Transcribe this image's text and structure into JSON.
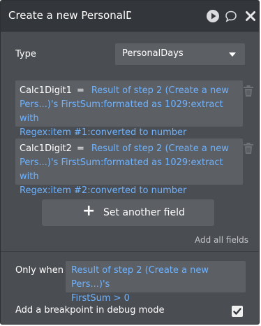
{
  "header": {
    "title": "Create a new PersonalDa",
    "icons": [
      "play-icon",
      "comment-icon",
      "close-icon"
    ]
  },
  "type_row": {
    "label": "Type",
    "value": "PersonalDays"
  },
  "fields": [
    {
      "name": "Calc1Digit1",
      "eq": "=",
      "expr_line1": "Result of step 2 (Create a new",
      "expr_line2": "Pers...)'s FirstSum:formatted as 1029:extract with",
      "expr_line3": "Regex:item #1:converted to number"
    },
    {
      "name": "Calc1Digit2",
      "eq": "=",
      "expr_line1": "Result of step 2 (Create a new",
      "expr_line2": "Pers...)'s FirstSum:formatted as 1029:extract with",
      "expr_line3": "Regex:item #2:converted to number"
    }
  ],
  "set_another_field": {
    "plus": "+",
    "label": "Set another field"
  },
  "add_all_fields": "Add all fields",
  "only_when": {
    "label": "Only when",
    "line1": "Result of step 2 (Create a new Pers...)'s",
    "line2": "FirstSum > 0"
  },
  "breakpoint": {
    "label": "Add a breakpoint in debug mode",
    "checked": true
  },
  "colors": {
    "panel_bg": "#4a4d52",
    "header_bg": "#33363a",
    "field_bg": "#5c5f64",
    "expression_blue": "#6fb3ff"
  }
}
